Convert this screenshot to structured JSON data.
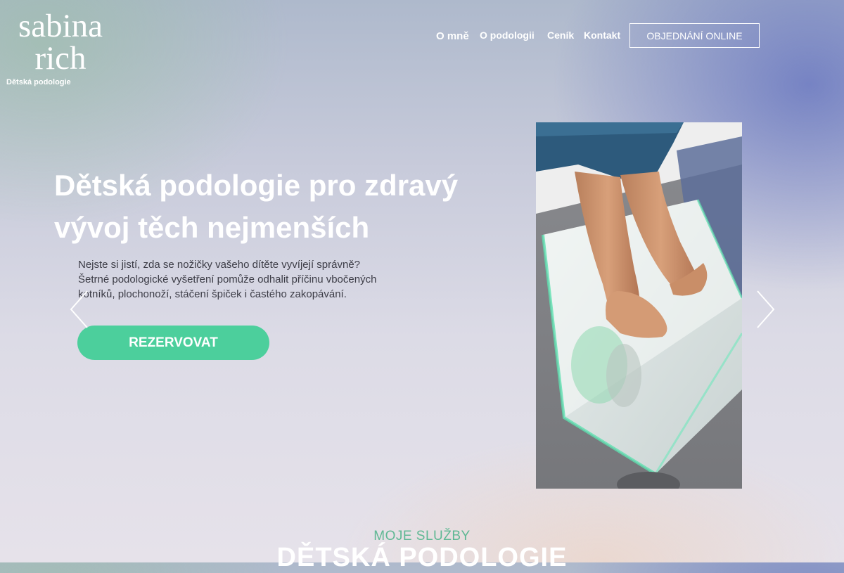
{
  "brand": {
    "name_line1": "sabina",
    "name_line2": "rich",
    "tagline": "Dětská podologie"
  },
  "nav": {
    "items": [
      {
        "label": "O mně"
      },
      {
        "label": "O podologii"
      },
      {
        "label": "Ceník"
      },
      {
        "label": "Kontakt"
      }
    ],
    "cta_label": "OBJEDNÁNÍ ONLINE"
  },
  "hero": {
    "title_line1": "Dětská podologie pro zdravý",
    "title_line2": "vývoj těch nejmenších",
    "text_line1": "Nejste si jistí, zda se nožičky vašeho dítěte vyvíjejí správně?",
    "text_line2": "Šetrné podologické vyšetření pomůže odhalit příčinu vbočených",
    "text_line3": "kotníků, plochonoží, stáčení špiček i častého zakopávání.",
    "cta_label": "REZERVOVAT",
    "image_icon": "child-feet-on-podoscope-photo"
  },
  "services": {
    "kicker": "MOJE SLUŽBY",
    "title": "DĚTSKÁ PODOLOGIE"
  },
  "icons": {
    "prev": "chevron-left-icon",
    "next": "chevron-right-icon"
  },
  "colors": {
    "accent": "#4ccf9c",
    "kicker": "#5fb894",
    "nav_text": "#ffffff"
  }
}
